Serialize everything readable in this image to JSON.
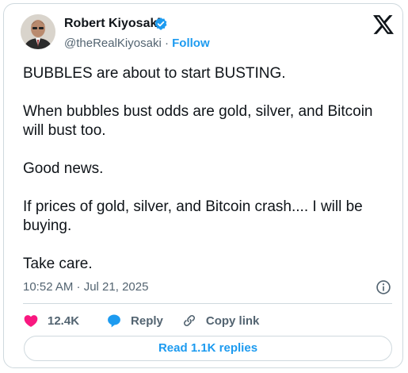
{
  "author": {
    "name": "Robert Kiyosaki",
    "handle": "@theRealKiyosaki",
    "separator": "·",
    "follow_label": "Follow",
    "avatar_icon": "portrait-avatar",
    "verified_icon": "verified-badge-icon"
  },
  "platform_icon": "x-logo-icon",
  "tweet": {
    "paragraphs": [
      "BUBBLES are about to start BUSTING.",
      "When bubbles bust odds are gold, silver, and Bitcoin will bust too.",
      "Good news.",
      "If prices of gold, silver, and Bitcoin crash.... I will be buying.",
      "Take care."
    ],
    "timestamp": "10:52 AM · Jul 21, 2025"
  },
  "actions": {
    "like_count": "12.4K",
    "reply_label": "Reply",
    "copy_link_label": "Copy link"
  },
  "read_replies_label": "Read 1.1K replies",
  "colors": {
    "accent": "#1d9bf0",
    "like": "#f91880",
    "text": "#0f1419",
    "secondary": "#536471",
    "border": "#cfd9de"
  }
}
